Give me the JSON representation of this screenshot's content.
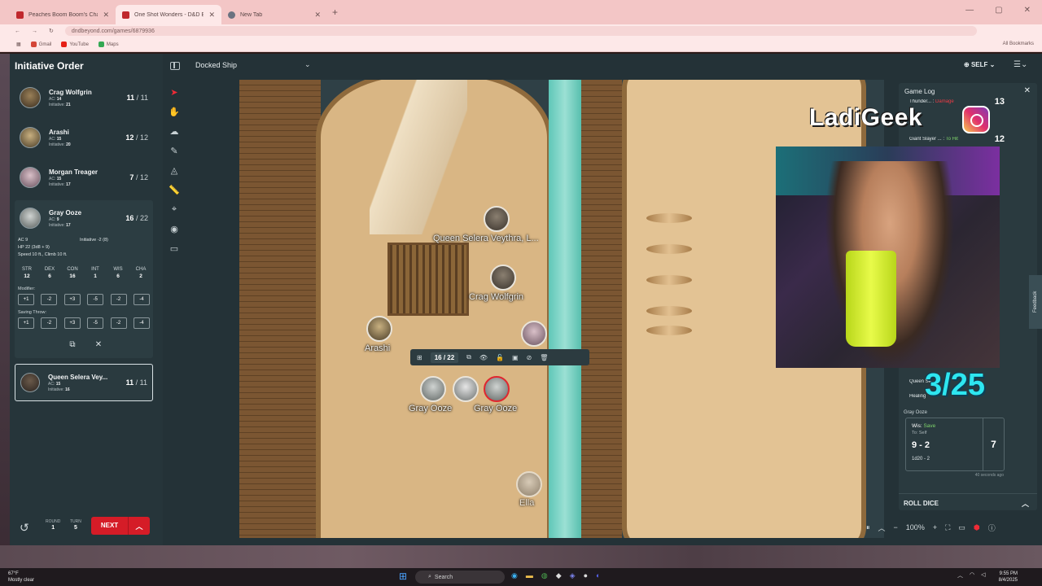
{
  "browser": {
    "tabs": [
      {
        "label": "Peaches Boom Boom's Charact"
      },
      {
        "label": "One Shot Wonders - D&D Beyo"
      },
      {
        "label": "New Tab"
      }
    ],
    "url": "dndbeyond.com/games/6879936",
    "bookmarks": [
      "Gmail",
      "YouTube",
      "Maps"
    ],
    "all_bookmarks": "All Bookmarks"
  },
  "initiative": {
    "title": "Initiative Order",
    "combatants": [
      {
        "name": "Crag Wolfgrin",
        "ac": "14",
        "initiative": "21",
        "hp": "11",
        "max": "11"
      },
      {
        "name": "Arashi",
        "ac": "15",
        "initiative": "20",
        "hp": "12",
        "max": "12"
      },
      {
        "name": "Morgan Treager",
        "ac": "15",
        "initiative": "17",
        "hp": "7",
        "max": "12"
      },
      {
        "name": "Gray Ooze",
        "ac": "9",
        "initiative": "17",
        "hp": "16",
        "max": "22"
      }
    ],
    "queen": {
      "name": "Queen Selera Vey...",
      "ac": "15",
      "initiative": "16",
      "hp": "11",
      "max": "11"
    },
    "labels": {
      "ac": "AC:",
      "initiative": "Initiative:"
    },
    "expanded": {
      "ac": "AC 9",
      "initiative": "Initiative -2 (8)",
      "hp": "HP 22 (3d8 + 9)",
      "speed": "Speed 10 ft., Climb 10 ft.",
      "abilities": [
        {
          "name": "STR",
          "score": "12"
        },
        {
          "name": "DEX",
          "score": "6"
        },
        {
          "name": "CON",
          "score": "16"
        },
        {
          "name": "INT",
          "score": "1"
        },
        {
          "name": "WIS",
          "score": "6"
        },
        {
          "name": "CHA",
          "score": "2"
        }
      ],
      "modifier_label": "Modifier:",
      "modifiers": [
        "+1",
        "-2",
        "+3",
        "-5",
        "-2",
        "-4"
      ],
      "saving_label": "Saving Throw:",
      "saves": [
        "+1",
        "-2",
        "+3",
        "-5",
        "-2",
        "-4"
      ]
    },
    "footer": {
      "round_label": "ROUND",
      "round": "1",
      "turn_label": "TURN",
      "turn": "5",
      "next": "NEXT"
    }
  },
  "map": {
    "name": "Docked Ship",
    "self_label": "SELF",
    "tokens": {
      "queen": "Queen Selera Veythra, L...",
      "crag": "Crag Wolfgrin",
      "arashi": "Arashi",
      "ooze1": "Gray Ooze",
      "ooze2": "Gray Ooze",
      "ella": "Ella"
    },
    "token_hp": "16 / 22",
    "zoom": "100%"
  },
  "gamelog": {
    "title": "Game Log",
    "entries": [
      {
        "source": "Thunder... :",
        "tag": "Damage",
        "value": "13"
      },
      {
        "source": "Giant Slayer ... :",
        "tag": "To Hit",
        "value": "12"
      }
    ],
    "queen_partial": "Queen Se",
    "healing_partial": "Healing",
    "card": {
      "source": "Gray Ooze",
      "label": "Wis:",
      "result": "Save",
      "target": "To: Self",
      "expr": "9 - 2",
      "dice": "1d20 - 2",
      "total": "7",
      "ago": "40 seconds ago"
    },
    "roll_dice": "ROLL DICE"
  },
  "overlay": {
    "brand": "LadiGeek",
    "day_count": "3/25"
  },
  "taskbar": {
    "temp": "67°F",
    "weather": "Mostly clear",
    "search": "Search",
    "time": "9:55 PM",
    "date": "8/4/2025"
  },
  "feedback": "Feedback",
  "colors": {
    "accent": "#d51c27",
    "panel": "#26353a",
    "save": "#7fd46b",
    "damage": "#ef3b45"
  }
}
